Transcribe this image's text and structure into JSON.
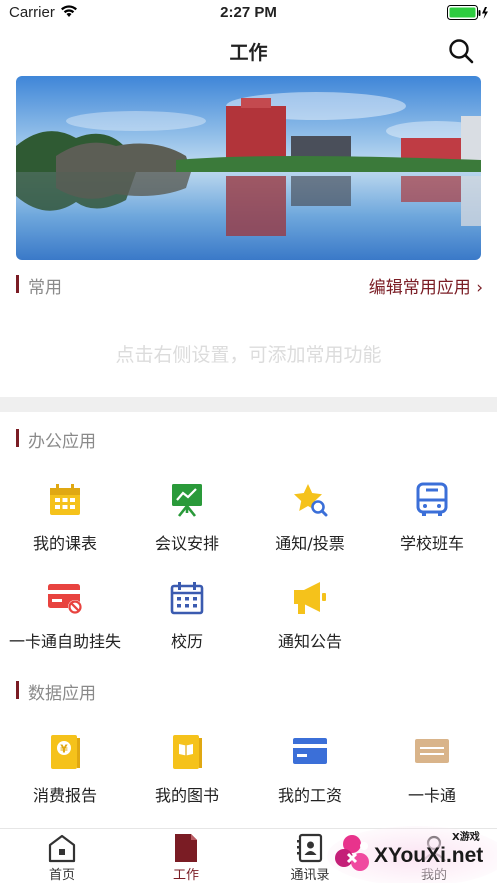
{
  "status_bar": {
    "carrier": "Carrier",
    "time": "2:27 PM"
  },
  "nav": {
    "title": "工作"
  },
  "common": {
    "label": "常用",
    "edit_label": "编辑常用应用 ›",
    "empty_hint": "点击右侧设置，可添加常用功能"
  },
  "office": {
    "label": "办公应用",
    "items": [
      {
        "label": "我的课表",
        "icon": "calendar-icon"
      },
      {
        "label": "会议安排",
        "icon": "presentation-board-icon"
      },
      {
        "label": "通知/投票",
        "icon": "star-search-icon"
      },
      {
        "label": "学校班车",
        "icon": "bus-icon"
      },
      {
        "label": "一卡通自助挂失",
        "icon": "card-block-icon"
      },
      {
        "label": "校历",
        "icon": "school-calendar-icon"
      },
      {
        "label": "通知公告",
        "icon": "megaphone-icon"
      }
    ]
  },
  "data_apps": {
    "label": "数据应用",
    "items": [
      {
        "label": "消费报告",
        "icon": "yuan-report-icon"
      },
      {
        "label": "我的图书",
        "icon": "book-icon"
      },
      {
        "label": "我的工资",
        "icon": "salary-card-icon"
      },
      {
        "label": "一卡通",
        "icon": "campus-card-icon"
      }
    ]
  },
  "tabs": [
    {
      "label": "首页",
      "icon": "home-icon"
    },
    {
      "label": "工作",
      "icon": "document-icon",
      "active": true
    },
    {
      "label": "通讯录",
      "icon": "contacts-icon"
    },
    {
      "label": "我的",
      "icon": "profile-icon"
    }
  ],
  "watermark": {
    "text": "XYouXi.net",
    "small": "X游戏"
  },
  "colors": {
    "accent": "#7a1c24",
    "yellow": "#f5c21b",
    "green": "#2a9a3a",
    "blue": "#3b6fd8",
    "red": "#e8433f",
    "tan": "#d9b48a"
  }
}
